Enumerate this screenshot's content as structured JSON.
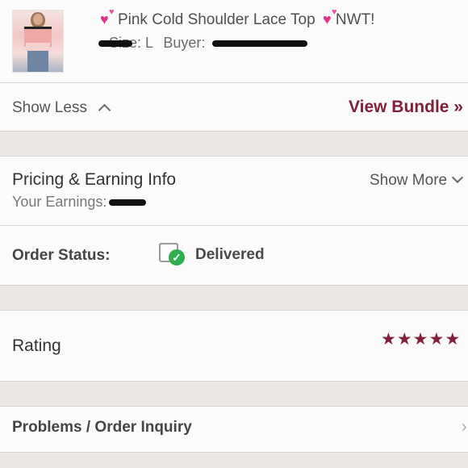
{
  "item": {
    "title": "Pink Cold Shoulder Lace Top",
    "suffix": "NWT!",
    "size_label": "Size: L",
    "buyer_label": "Buyer:"
  },
  "links": {
    "show_less": "Show Less",
    "view_bundle": "View Bundle »"
  },
  "pricing": {
    "title": "Pricing & Earning Info",
    "earnings_label": "Your Earnings:",
    "show_more": "Show More"
  },
  "order": {
    "status_label": "Order Status:",
    "status_value": "Delivered"
  },
  "rating": {
    "label": "Rating",
    "stars": 5
  },
  "problems": {
    "label": "Problems / Order Inquiry"
  },
  "colors": {
    "accent": "#7f1f3a",
    "success": "#2fae4f"
  }
}
